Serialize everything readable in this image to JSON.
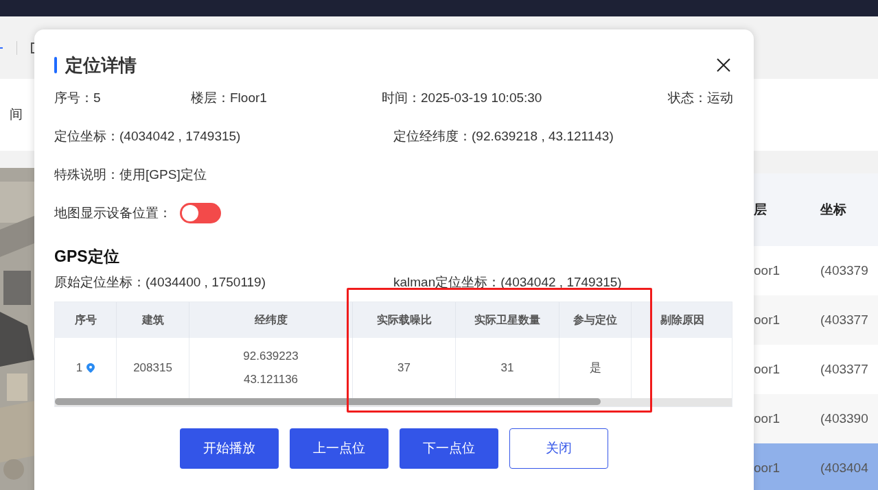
{
  "background": {
    "filter_label": "间",
    "table": {
      "columns": [
        "层",
        "坐标"
      ],
      "rows": [
        {
          "cells": [
            "oor1",
            "(403379"
          ],
          "selected": false
        },
        {
          "cells": [
            "oor1",
            "(403377"
          ],
          "selected": false
        },
        {
          "cells": [
            "oor1",
            "(403377"
          ],
          "selected": false
        },
        {
          "cells": [
            "oor1",
            "(403390"
          ],
          "selected": false
        },
        {
          "cells": [
            "oor1",
            "(403404"
          ],
          "selected": true
        }
      ]
    }
  },
  "dialog": {
    "title": "定位详情",
    "info_rows": [
      [
        {
          "label": "序号：",
          "value": "5"
        },
        {
          "label": "楼层：",
          "value": "Floor1"
        },
        {
          "label": "时间：",
          "value": "2025-03-19 10:05:30"
        },
        {
          "label": "状态：",
          "value": "运动"
        }
      ],
      [
        {
          "label": "定位坐标：",
          "value": "(4034042 , 1749315)"
        },
        {
          "label": "定位经纬度：",
          "value": "(92.639218 , 43.121143)"
        }
      ],
      [
        {
          "label": "特殊说明：",
          "value": "使用[GPS]定位"
        }
      ]
    ],
    "map_toggle": {
      "label": "地图显示设备位置：",
      "on": false
    },
    "section_title": "GPS定位",
    "coords": [
      {
        "label": "原始定位坐标：",
        "value": "(4034400 , 1750119)"
      },
      {
        "label": "kalman定位坐标：",
        "value": "(4034042 , 1749315)"
      }
    ],
    "table": {
      "columns": [
        "序号",
        "建筑",
        "经纬度",
        "实际载噪比",
        "实际卫星数量",
        "参与定位",
        "剔除原因"
      ],
      "rows": [
        {
          "cells": [
            "1",
            "208315",
            [
              "92.639223",
              "43.121136"
            ],
            "37",
            "31",
            "是"
          ]
        }
      ]
    },
    "buttons": [
      {
        "label": "开始播放",
        "kind": "primary"
      },
      {
        "label": "上一点位",
        "kind": "primary"
      },
      {
        "label": "下一点位",
        "kind": "primary"
      },
      {
        "label": "关闭",
        "kind": "outline"
      }
    ]
  }
}
